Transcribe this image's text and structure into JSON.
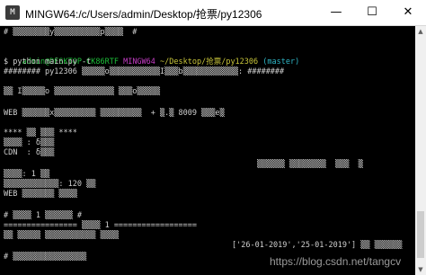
{
  "window": {
    "icon_text": "M",
    "title": "MINGW64:/c/Users/admin/Desktop/抢票/py12306",
    "minimize_glyph": "—",
    "maximize_glyph": "☐",
    "close_glyph": "✕"
  },
  "terminal": {
    "line_top": "# ▒▒▒▒▒▒▒▒y▒▒▒▒▒▒▒▒▒▒p▒▒▒▒  #",
    "prompt_user": "admin@DESKTOP-CK86RTF",
    "prompt_shell": "MINGW64",
    "prompt_path": "~/Desktop/抢票/py12306",
    "prompt_branch": "(master)",
    "command": "$ python main.py -t",
    "banner": "######## py12306 ▒▒▒▒▒o▒▒▒▒▒▒▒▒▒▒▒I▒▒▒b▒▒▒▒▒▒▒▒▒▒▒▒: ########",
    "line_check": "▒▒ I▒▒▒▒▒o ▒▒▒▒▒▒▒▒▒▒▒▒▒ ▒▒▒o▒▒▒▒▒",
    "line_web": "WEB ▒▒▒▒▒▒x▒▒▒▒▒▒▒▒▒ ▒▒▒▒▒▒▒▒▒  + ▒.▒ 8009 ▒▒▒e▒",
    "section_header": "**** ▒▒ ▒▒▒ ****",
    "line_stat1": "▒▒▒▒ : δ▒▒▒",
    "line_cdn": "CDN  : δ▒▒▒",
    "right_status": "▒▒▒▒▒▒ ▒▒▒▒▒▒▒▒  ▒▒▒  ▒",
    "line_count": "▒▒▒▒: 1 ▒▒",
    "line_interval": "▒▒▒▒▒▒▒▒▒▒▒▒: 120 ▒▒",
    "line_web2": "WEB ▒▒▒▒▒▒▒ ▒▒▒▒",
    "line_query": "# ▒▒▒▒ 1 ▒▒▒▒▒▒ #",
    "separator": "================ ▒▒▒▒ 1 ==================",
    "line_dates": "▒▒ ▒▒▒▒▒ ▒▒▒▒▒▒▒▒▒▒▒ ▒▒▒▒",
    "dates": "['26-01-2019','25-01-2019'] ▒▒ ▒▒▒▒▒▒",
    "line_bottom": "# ▒▒▒▒▒▒▒▒▒▒▒▒▒▒▒▒"
  },
  "watermark": "https://blog.csdn.net/tangcv",
  "colors": {
    "background": "#000000",
    "text": "#cfcfcf",
    "user": "#1dbf39",
    "shell": "#c63dc6",
    "path": "#c7c43a",
    "branch": "#2fb6c6"
  }
}
